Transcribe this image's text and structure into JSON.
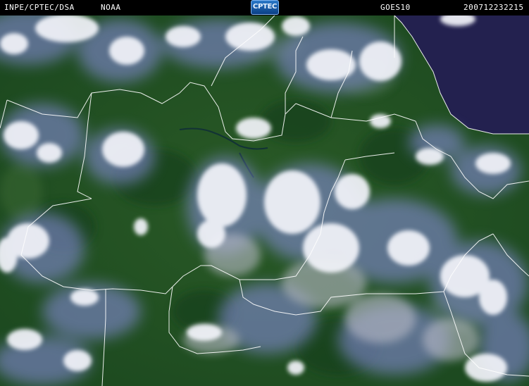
{
  "header": {
    "left_label": "INPE/CPTEC/DSA",
    "noaa_label": "NOAA",
    "logo_text": "CPTEC",
    "satellite_label": "GOES10",
    "timestamp": "200712232215"
  },
  "colors": {
    "land": "#1f4d22",
    "ocean": "#22204f",
    "cloud": "#f2f3f8",
    "cloud_edge": "#8c8fe6",
    "borders": "#ffffff"
  }
}
